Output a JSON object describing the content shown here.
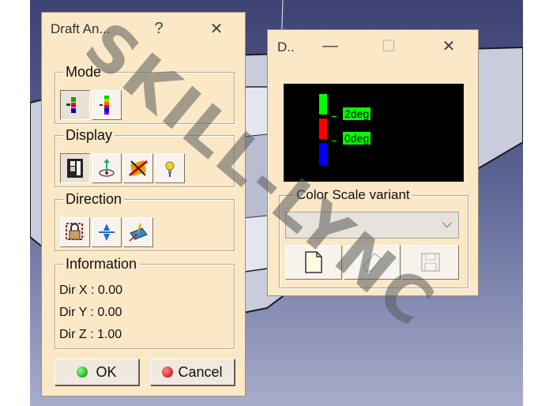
{
  "draft_dialog": {
    "title": "Draft An...",
    "help_label": "?",
    "close_label": "✕",
    "groups": {
      "mode": "Mode",
      "display": "Display",
      "direction": "Direction",
      "information": "Information"
    },
    "info": {
      "dir_x": "Dir X : 0.00",
      "dir_y": "Dir Y : 0.00",
      "dir_z": "Dir Z : 1.00"
    },
    "ok_label": "OK",
    "cancel_label": "Cancel"
  },
  "color_dialog": {
    "title": "D..",
    "minimize_label": "—",
    "maximize_label": "☐",
    "close_label": "✕",
    "scale_labels": [
      "2deg",
      "0deg"
    ],
    "scale_colors": [
      "#00ff00",
      "#ff0000",
      "#0000ff"
    ],
    "variant_group": "Color Scale variant",
    "variant_value": ""
  },
  "watermark": "SKILL-LYNC"
}
